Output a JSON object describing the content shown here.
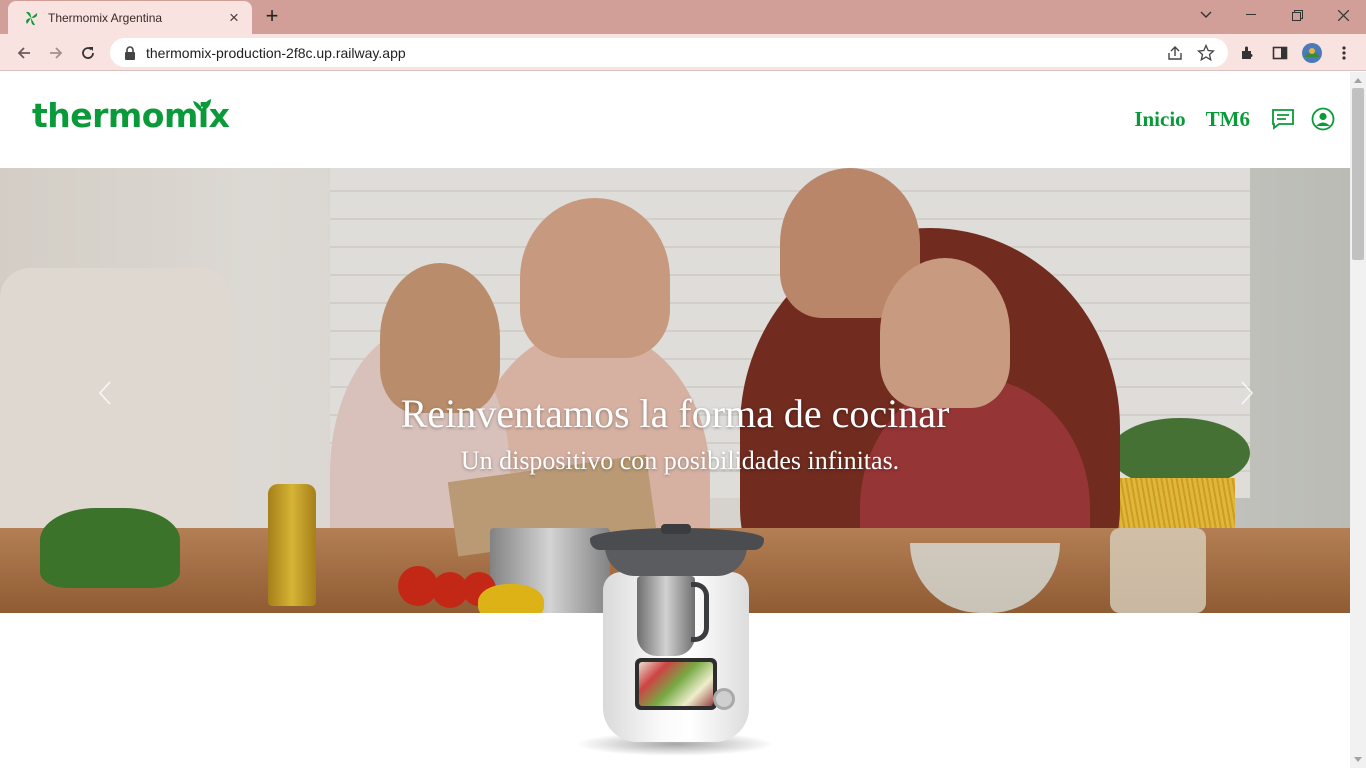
{
  "browser": {
    "tab_title": "Thermomix Argentina",
    "url": "thermomix-production-2f8c.up.railway.app"
  },
  "site": {
    "logo_text": "thermomix",
    "nav": [
      {
        "label": "Inicio"
      },
      {
        "label": "TM6"
      }
    ],
    "brand_color": "#0a9a3a"
  },
  "hero": {
    "title": "Reinventamos la forma de cocinar",
    "subtitle": "Un dispositivo con posibilidades infinitas."
  }
}
